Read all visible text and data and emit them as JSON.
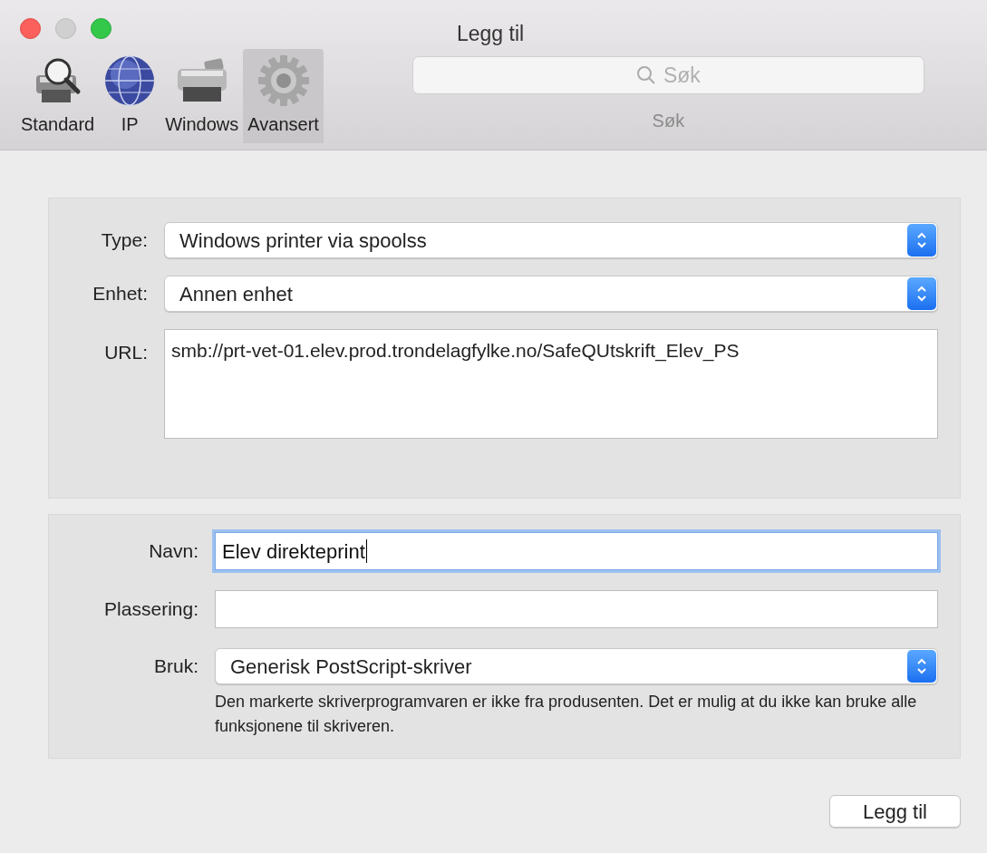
{
  "window": {
    "title": "Legg til"
  },
  "toolbar": {
    "items": [
      {
        "label": "Standard",
        "kind": "printer-search",
        "selected": false
      },
      {
        "label": "IP",
        "kind": "globe",
        "selected": false
      },
      {
        "label": "Windows",
        "kind": "printer",
        "selected": false
      },
      {
        "label": "Avansert",
        "kind": "gear",
        "selected": true
      }
    ],
    "search": {
      "placeholder": "Søk",
      "label": "Søk"
    }
  },
  "connection": {
    "fields": [
      {
        "kind": "select",
        "label": "Type:",
        "value": "Windows printer via spoolss"
      },
      {
        "kind": "select",
        "label": "Enhet:",
        "value": "Annen enhet"
      },
      {
        "kind": "textarea",
        "label": "URL:",
        "value": "smb://prt-vet-01.elev.prod.trondelagfylke.no/SafeQUtskrift_Elev_PS"
      }
    ]
  },
  "details": {
    "fields": [
      {
        "kind": "text",
        "label": "Navn:",
        "value": "Elev direkteprint",
        "focused": true
      },
      {
        "kind": "text",
        "label": "Plassering:",
        "focused": false
      },
      {
        "kind": "select",
        "label": "Bruk:",
        "value": "Generisk PostScript-skriver"
      }
    ],
    "note": "Den markerte skriverprogramvaren er ikke fra produsenten. Det er mulig at du ikke kan bruke alle funksjonene til skriveren."
  },
  "buttons": [
    "Legg til"
  ]
}
